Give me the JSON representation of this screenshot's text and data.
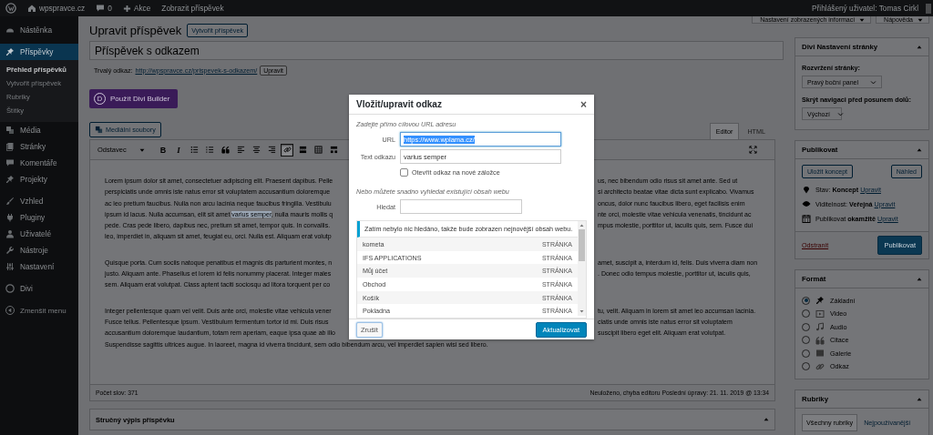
{
  "top_bar": {
    "site": "wpspravce.cz",
    "comments": "0",
    "new": "Akce",
    "view": "Zobrazit příspěvek",
    "user": "Přihlášený uživatel: Tomas Cirkl"
  },
  "sidebar": {
    "groups": [
      [
        {
          "label": "Nástěnka",
          "kind": "gauge",
          "selected": false
        }
      ],
      [
        {
          "label": "Příspěvky",
          "kind": "pin",
          "selected": true,
          "children": [
            {
              "label": "Přehled příspěvků",
              "selected": true
            },
            {
              "label": "Vytvořit příspěvek",
              "selected": false
            },
            {
              "label": "Rubriky",
              "selected": false
            },
            {
              "label": "Štítky",
              "selected": false
            }
          ]
        },
        {
          "label": "Média",
          "kind": "media",
          "selected": false
        },
        {
          "label": "Stránky",
          "kind": "pages",
          "selected": false
        },
        {
          "label": "Komentáře",
          "kind": "comment",
          "selected": false
        },
        {
          "label": "Projekty",
          "kind": "pin",
          "selected": false
        }
      ],
      [
        {
          "label": "Vzhled",
          "kind": "brush",
          "selected": false
        },
        {
          "label": "Pluginy",
          "kind": "plug",
          "selected": false
        },
        {
          "label": "Uživatelé",
          "kind": "user",
          "selected": false
        },
        {
          "label": "Nástroje",
          "kind": "wrench",
          "selected": false
        },
        {
          "label": "Nastavení",
          "kind": "settings",
          "selected": false
        }
      ],
      [
        {
          "label": "Divi",
          "kind": "divi",
          "selected": false
        }
      ]
    ],
    "collapse": "Zmenšit menu"
  },
  "screen_tabs": [
    "Nastavení zobrazených informací",
    "Nápověda"
  ],
  "editor": {
    "heading": "Upravit příspěvek",
    "add_new": "Vytvořit příspěvek",
    "title": "Příspěvek s odkazem",
    "permalink_label": "Trvalý odkaz:",
    "permalink": "http://wpspravce.cz/prispevek-s-odkazem/",
    "permalink_edit": "Upravit",
    "divi_letter": "D",
    "divi_button": "Použít Divi Builder",
    "media_button": "Mediální soubory",
    "tabs": [
      {
        "label": "Editor",
        "selected": true
      },
      {
        "label": "HTML",
        "selected": false
      }
    ],
    "format": "Odstavec",
    "toolbar": [
      {
        "kind": "bold",
        "label": "B",
        "active": false
      },
      {
        "kind": "italic",
        "label": "I",
        "active": false
      },
      {
        "kind": "bullets",
        "active": false
      },
      {
        "kind": "numbers",
        "active": false
      },
      {
        "kind": "quote",
        "active": false
      },
      {
        "kind": "alignleft",
        "active": false
      },
      {
        "kind": "aligncenter",
        "active": false
      },
      {
        "kind": "alignright",
        "active": false
      },
      {
        "kind": "link",
        "active": true
      },
      {
        "kind": "more",
        "active": false
      },
      {
        "kind": "table",
        "active": false
      },
      {
        "kind": "toggle",
        "active": false
      }
    ],
    "paragraphs": [
      [
        {
          "segments": [
            {
              "text": "Lorem ipsum dolor sit amet, consectetuer adipiscing elit. Praesent dapibus. Pelle",
              "selected": false
            }
          ],
          "right": "us, nec bibendum odio risus sit amet ante. Sed ut"
        },
        {
          "segments": [
            {
              "text": "perspiciatis unde omnis iste natus error sit voluptatem accusantium doloremque",
              "selected": false
            }
          ],
          "right": "si architecto beatae vitae dicta sunt explicabo. Vivamus"
        },
        {
          "segments": [
            {
              "text": "ac leo pretium faucibus. Nulla non arcu lacinia neque faucibus fringilla. Vestibulu",
              "selected": false
            }
          ],
          "right": "oncus, dolor nunc faucibus libero, eget facilisis enim"
        },
        {
          "segments": [
            {
              "text": "ipsum id lacus. Nulla accumsan, elit sit amet ",
              "selected": false
            },
            {
              "text": "varius semper",
              "selected": true
            },
            {
              "text": ", nulla mauris mollis q",
              "selected": false
            }
          ],
          "right": "nte orci, molestie vitae vehicula venenatis, tincidunt ac"
        },
        {
          "segments": [
            {
              "text": "pede. Cras pede libero, dapibus nec, pretium sit amet, tempor quis. In convallis.",
              "selected": false
            }
          ],
          "right": "mpus molestie, porttitor ut, iaculis quis, sem. Fusce dui"
        },
        {
          "segments": [
            {
              "text": "leo, imperdiet in, aliquam sit amet, feugiat eu, orci. Nulla est. Aliquam erat volutp",
              "selected": false
            }
          ]
        }
      ],
      [
        {
          "segments": [
            {
              "text": "Quisque porta. Cum sociis natoque penatibus et magnis dis parturient montes, n",
              "selected": false
            }
          ],
          "right": "amet, suscipit a, interdum id, felis. Duis viverra diam non"
        },
        {
          "segments": [
            {
              "text": "justo. Aliquam ante. Phasellus et lorem id felis nonummy placerat. Integer males",
              "selected": false
            }
          ],
          "right": ". Donec odio tempus molestie, porttitor ut, iaculis quis,"
        },
        {
          "segments": [
            {
              "text": "sem. Aliquam erat volutpat. Class aptent taciti sociosqu ad litora torquent per co",
              "selected": false
            }
          ]
        }
      ],
      [
        {
          "segments": [
            {
              "text": "Integer pellentesque quam vel velit. Duis ante orci, molestie vitae vehicula vener",
              "selected": false
            }
          ],
          "right": "tu, velit. Aliquam in lorem sit amet leo accumsan lacinia."
        },
        {
          "segments": [
            {
              "text": "Fusce tellus. Pellentesque ipsum. Vestibulum fermentum tortor id mi. Duis risus",
              "selected": false
            }
          ],
          "right": "ciatis unde omnis iste natus error sit voluptatem"
        },
        {
          "segments": [
            {
              "text": "accusantium doloremque laudantium, totam rem aperiam, eaque ipsa quae ab illo",
              "selected": false
            }
          ],
          "right": "suscipit libero eget elit. Aliquam erat volutpat."
        },
        {
          "segments": [
            {
              "text": "Suspendisse sagittis ultrices augue. In laoreet, magna id viverra tincidunt, sem odio bibendum arcu, vel imperdiet sapien wisi sed libero.",
              "selected": false
            }
          ]
        }
      ]
    ],
    "word_count": "Počet slov: 371",
    "save_status": "Neuloženo, chyba editoru Poslední úpravy: 21. 11. 2019 @ 13:34"
  },
  "excerpt_box": {
    "title": "Stručný výpis příspěvku"
  },
  "divi_settings": {
    "title": "Divi Nastavení stránky",
    "layout_label": "Rozvržení stránky:",
    "layout": "Pravý boční panel",
    "nav_label": "Skrýt navigaci před posunem dolů:",
    "nav": "Výchozí"
  },
  "publish": {
    "title": "Publikovat",
    "save_draft": "Uložit koncept",
    "preview": "Náhled",
    "rows": [
      {
        "kind": "status",
        "text": "Stav: **Koncept**",
        "link": "Upravit"
      },
      {
        "kind": "visibility",
        "text": "Viditelnost: **Veřejná**",
        "link": "Upravit"
      },
      {
        "kind": "schedule",
        "text": "Publikovat **okamžitě**",
        "link": "Upravit"
      }
    ],
    "delete": "Odstranit",
    "publish": "Publikovat"
  },
  "format": {
    "title": "Formát",
    "options": [
      {
        "label": "Základní",
        "kind": "standard",
        "selected": true
      },
      {
        "label": "Video",
        "kind": "video",
        "selected": false
      },
      {
        "label": "Audio",
        "kind": "audio",
        "selected": false
      },
      {
        "label": "Citace",
        "kind": "quote",
        "selected": false
      },
      {
        "label": "Galerie",
        "kind": "gallery",
        "selected": false
      },
      {
        "label": "Odkaz",
        "kind": "link",
        "selected": false
      }
    ]
  },
  "categories": {
    "title": "Rubriky",
    "tabs": [
      {
        "label": "Všechny rubriky",
        "selected": true
      },
      {
        "label": "Nejpoužívanější",
        "selected": false
      }
    ]
  },
  "link_modal": {
    "title": "Vložit/upravit odkaz",
    "close": "×",
    "url_hint": "Zadejte přímo cílovou URL adresu",
    "url_label": "URL",
    "url": "https://www.wplama.cz/",
    "url_selected": true,
    "text_label": "Text odkazu",
    "text": "varius semper",
    "new_tab_label": "Otevřít odkaz na nové záložce",
    "new_tab": false,
    "search_hint": "Nebo můžete snadno vyhledat existující obsah webu",
    "search_label": "Hledat",
    "notice": "Zatím nebylo nic hledáno, takže bude zobrazen nejnovější obsah webu.",
    "results": [
      {
        "title": "kometa",
        "type": "STRÁNKA"
      },
      {
        "title": "IFS APPLICATIONS",
        "type": "STRÁNKA"
      },
      {
        "title": "Můj účet",
        "type": "STRÁNKA"
      },
      {
        "title": "Obchod",
        "type": "STRÁNKA"
      },
      {
        "title": "Košík",
        "type": "STRÁNKA"
      },
      {
        "title": "Pokladna",
        "type": "STRÁNKA"
      }
    ],
    "cancel": "Zrušit",
    "submit": "Aktualizovat"
  }
}
